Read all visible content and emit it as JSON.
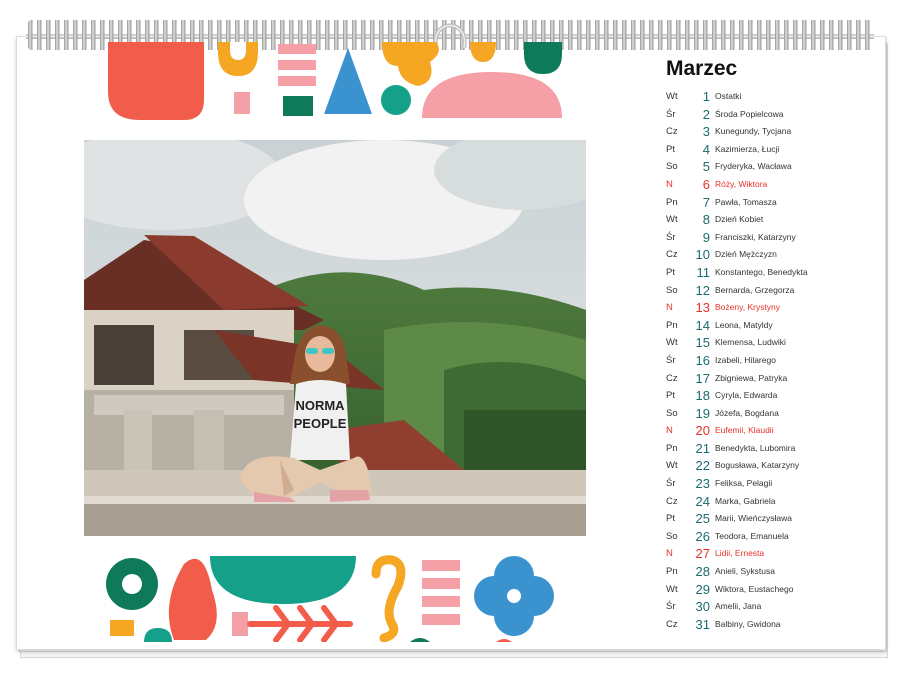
{
  "calendar": {
    "month": "Marzec",
    "colors": {
      "sunday": "#e8312a",
      "day_number": "#1a6b72",
      "text": "#333333"
    },
    "days": [
      {
        "dow": "Wt",
        "day": "1",
        "names": "Ostatki",
        "sunday": false
      },
      {
        "dow": "Śr",
        "day": "2",
        "names": "Środa Popielcowa",
        "sunday": false
      },
      {
        "dow": "Cz",
        "day": "3",
        "names": "Kunegundy, Tycjana",
        "sunday": false
      },
      {
        "dow": "Pt",
        "day": "4",
        "names": "Kazimierza, Łucji",
        "sunday": false
      },
      {
        "dow": "So",
        "day": "5",
        "names": "Fryderyka, Wacława",
        "sunday": false
      },
      {
        "dow": "N",
        "day": "6",
        "names": "Róży, Wiktora",
        "sunday": true
      },
      {
        "dow": "Pn",
        "day": "7",
        "names": "Pawła, Tomasza",
        "sunday": false
      },
      {
        "dow": "Wt",
        "day": "8",
        "names": "Dzień Kobiet",
        "sunday": false
      },
      {
        "dow": "Śr",
        "day": "9",
        "names": "Franciszki, Katarzyny",
        "sunday": false
      },
      {
        "dow": "Cz",
        "day": "10",
        "names": "Dzień Mężczyzn",
        "sunday": false
      },
      {
        "dow": "Pt",
        "day": "11",
        "names": "Konstantego, Benedykta",
        "sunday": false
      },
      {
        "dow": "So",
        "day": "12",
        "names": "Bernarda, Grzegorza",
        "sunday": false
      },
      {
        "dow": "N",
        "day": "13",
        "names": "Bożeny, Krystyny",
        "sunday": true
      },
      {
        "dow": "Pn",
        "day": "14",
        "names": "Leona, Matyldy",
        "sunday": false
      },
      {
        "dow": "Wt",
        "day": "15",
        "names": "Klemensa, Ludwiki",
        "sunday": false
      },
      {
        "dow": "Śr",
        "day": "16",
        "names": "Izabeli, Hilarego",
        "sunday": false
      },
      {
        "dow": "Cz",
        "day": "17",
        "names": "Zbigniewa, Patryka",
        "sunday": false
      },
      {
        "dow": "Pt",
        "day": "18",
        "names": "Cyryla, Edwarda",
        "sunday": false
      },
      {
        "dow": "So",
        "day": "19",
        "names": "Józefa, Bogdana",
        "sunday": false
      },
      {
        "dow": "N",
        "day": "20",
        "names": "Eufemii, Klaudii",
        "sunday": true
      },
      {
        "dow": "Pn",
        "day": "21",
        "names": "Benedykta, Lubomira",
        "sunday": false
      },
      {
        "dow": "Wt",
        "day": "22",
        "names": "Bogusława, Katarzyny",
        "sunday": false
      },
      {
        "dow": "Śr",
        "day": "23",
        "names": "Feliksa, Pelagii",
        "sunday": false
      },
      {
        "dow": "Cz",
        "day": "24",
        "names": "Marka, Gabriela",
        "sunday": false
      },
      {
        "dow": "Pt",
        "day": "25",
        "names": "Marii, Wieńczysława",
        "sunday": false
      },
      {
        "dow": "So",
        "day": "26",
        "names": "Teodora, Emanuela",
        "sunday": false
      },
      {
        "dow": "N",
        "day": "27",
        "names": "Lidii, Ernesta",
        "sunday": true
      },
      {
        "dow": "Pn",
        "day": "28",
        "names": "Anieli, Sykstusa",
        "sunday": false
      },
      {
        "dow": "Wt",
        "day": "29",
        "names": "Wiktora, Eustachego",
        "sunday": false
      },
      {
        "dow": "Śr",
        "day": "30",
        "names": "Amelii, Jana",
        "sunday": false
      },
      {
        "dow": "Cz",
        "day": "31",
        "names": "Balbiny, Gwidona",
        "sunday": false
      }
    ]
  },
  "photo_shirt_text": [
    "NORMA",
    "PEOPLE"
  ],
  "decoration_colors": {
    "coral": "#f25c4a",
    "orange": "#f5a623",
    "pink": "#f4a0a6",
    "blue": "#3a93cf",
    "green": "#0e7a5a",
    "teal": "#15a08a"
  }
}
